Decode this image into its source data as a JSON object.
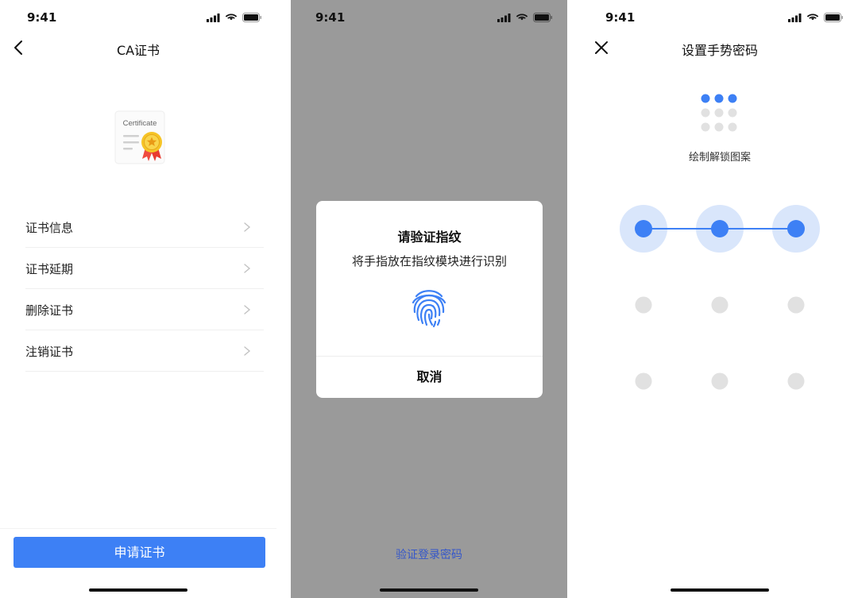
{
  "colors": {
    "accent": "#3d80f5",
    "overlay": "#9a9a9a",
    "link": "#3557c9",
    "dot_inactive": "#e1e1e1",
    "dot_halo": "#d9e6fb"
  },
  "screens": [
    {
      "status_time": "9:41",
      "title": "CA证书",
      "nav_icon": "back-chevron-icon",
      "cert_label": "Certificate",
      "menu": [
        {
          "label": "证书信息"
        },
        {
          "label": "证书延期"
        },
        {
          "label": "删除证书"
        },
        {
          "label": "注销证书"
        }
      ],
      "primary_button": "申请证书"
    },
    {
      "status_time": "9:41",
      "dialog": {
        "title": "请验证指纹",
        "message": "将手指放在指纹模块进行识别",
        "icon": "fingerprint-icon",
        "cancel": "取消"
      },
      "link": "验证登录密码"
    },
    {
      "status_time": "9:41",
      "title": "设置手势密码",
      "nav_icon": "close-icon",
      "hint": "绘制解锁图案",
      "pattern_selected": [
        0,
        1,
        2
      ]
    }
  ]
}
